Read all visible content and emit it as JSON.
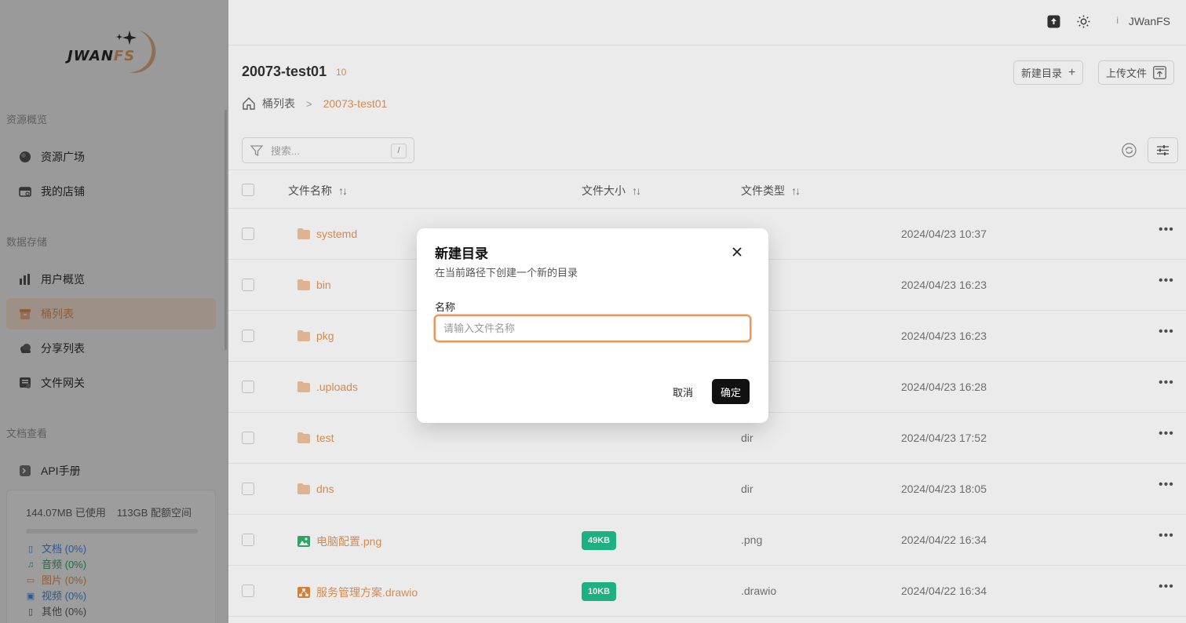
{
  "brand": {
    "logo_text_a": "JWAN",
    "logo_text_b": "FS"
  },
  "sidebar": {
    "sections": [
      {
        "title": "资源概览",
        "items": [
          {
            "label": "资源广场",
            "icon": "globe-icon"
          },
          {
            "label": "我的店铺",
            "icon": "store-icon"
          }
        ]
      },
      {
        "title": "数据存储",
        "items": [
          {
            "label": "用户概览",
            "icon": "bar-chart-icon"
          },
          {
            "label": "桶列表",
            "icon": "bucket-icon",
            "active": true
          },
          {
            "label": "分享列表",
            "icon": "cloud-share-icon"
          },
          {
            "label": "文件网关",
            "icon": "gateway-icon"
          }
        ]
      },
      {
        "title": "文档查看",
        "items": [
          {
            "label": "API手册",
            "icon": "api-doc-icon"
          }
        ]
      }
    ],
    "storage": {
      "used": "144.07MB 已使用",
      "quota": "113GB 配额空间",
      "used_fraction": 0.0,
      "legend": [
        {
          "label": "文档 (0%)",
          "color": "#4a90e2",
          "icon": "document-icon"
        },
        {
          "label": "音频 (0%)",
          "color": "#2fb36d",
          "icon": "music-icon"
        },
        {
          "label": "图片 (0%)",
          "color": "#e8965a",
          "icon": "image-icon"
        },
        {
          "label": "视频 (0%)",
          "color": "#4a90e2",
          "icon": "video-icon"
        },
        {
          "label": "其他 (0%)",
          "color": "#666666",
          "icon": "file-icon"
        }
      ]
    }
  },
  "topbar": {
    "user_name": "JWanFS",
    "user_initial": "i"
  },
  "bucket": {
    "name": "20073-test01",
    "count": "10"
  },
  "toolbar": {
    "new_dir": "新建目录",
    "upload": "上传文件"
  },
  "breadcrumb": {
    "root": "桶列表",
    "current": "20073-test01"
  },
  "search": {
    "placeholder": "搜索...",
    "shortcut": "/"
  },
  "table": {
    "headers": {
      "name": "文件名称",
      "size": "文件大小",
      "type": "文件类型"
    },
    "rows": [
      {
        "name": "systemd",
        "kind": "folder",
        "size": "",
        "type": "",
        "date": "2024/04/23 10:37"
      },
      {
        "name": "bin",
        "kind": "folder",
        "size": "",
        "type": "",
        "date": "2024/04/23 16:23"
      },
      {
        "name": "pkg",
        "kind": "folder",
        "size": "",
        "type": "",
        "date": "2024/04/23 16:23"
      },
      {
        "name": ".uploads",
        "kind": "folder",
        "size": "",
        "type": "",
        "date": "2024/04/23 16:28"
      },
      {
        "name": "test",
        "kind": "folder",
        "size": "",
        "type": "dir",
        "date": "2024/04/23 17:52"
      },
      {
        "name": "dns",
        "kind": "folder",
        "size": "",
        "type": "dir",
        "date": "2024/04/23 18:05"
      },
      {
        "name": "电脑配置.png",
        "kind": "image",
        "size": "49KB",
        "type": ".png",
        "date": "2024/04/22 16:34"
      },
      {
        "name": "服务管理方案.drawio",
        "kind": "drawio",
        "size": "10KB",
        "type": ".drawio",
        "date": "2024/04/22 16:34"
      }
    ]
  },
  "dialog": {
    "title": "新建目录",
    "subtitle": "在当前路径下创建一个新的目录",
    "label": "名称",
    "placeholder": "请输入文件名称",
    "value": "",
    "cancel": "取消",
    "confirm": "确定"
  },
  "colors": {
    "accent": "#e8965a",
    "size_badge": "#1fbf8f",
    "primary_button": "#111111"
  }
}
